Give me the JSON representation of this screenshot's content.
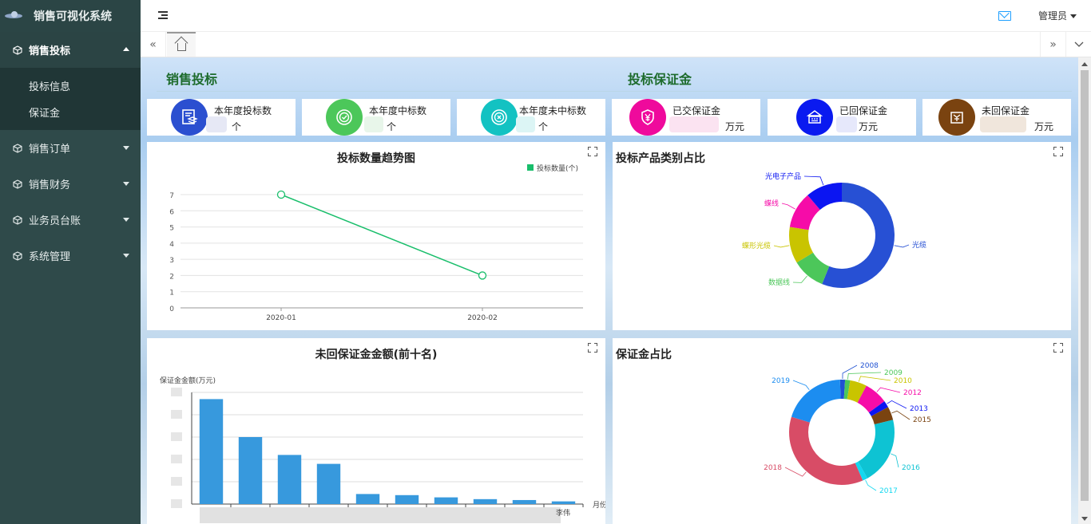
{
  "app": {
    "title": "销售可视化系统"
  },
  "sidebar": {
    "items": [
      {
        "label": "销售投标",
        "children": [
          {
            "label": "投标信息"
          },
          {
            "label": "保证金"
          }
        ]
      },
      {
        "label": "销售订单"
      },
      {
        "label": "销售财务"
      },
      {
        "label": "业务员台账"
      },
      {
        "label": "系统管理"
      }
    ]
  },
  "header": {
    "user": "管理员"
  },
  "sections": {
    "bid": "销售投标",
    "deposit": "投标保证金"
  },
  "stats": [
    {
      "label": "本年度投标数",
      "unit": "个",
      "color": "#2b4fd0"
    },
    {
      "label": "本年度中标数",
      "unit": "个",
      "color": "#4cc75a"
    },
    {
      "label": "本年度未中标数",
      "unit": "个",
      "color": "#13c2c2"
    },
    {
      "label": "已交保证金",
      "unit": "万元",
      "color": "#ef0a9c"
    },
    {
      "label": "已回保证金",
      "unit": "万元",
      "color": "#0a1af0"
    },
    {
      "label": "未回保证金",
      "unit": "万元",
      "color": "#7a4310"
    }
  ],
  "panels": {
    "trend": {
      "title": "投标数量趋势图"
    },
    "category": {
      "title": "投标产品类别占比"
    },
    "unreturned": {
      "title": "未回保证金金额(前十名)",
      "ylabel": "保证金金额(万元)",
      "xlabel": "月份",
      "last_name_fragment": "李伟"
    },
    "share": {
      "title": "保证金占比"
    }
  },
  "chart_data": [
    {
      "type": "line",
      "title": "投标数量趋势图",
      "x": [
        "2020-01",
        "2020-02"
      ],
      "series": [
        {
          "name": "投标数量(个)",
          "values": [
            7,
            2
          ],
          "color": "#19be6b"
        }
      ],
      "ylim": [
        0,
        7
      ],
      "yticks": [
        0,
        1,
        2,
        3,
        4,
        5,
        6,
        7
      ],
      "legend": "top-right",
      "grid": true
    },
    {
      "type": "pie",
      "title": "投标产品类别占比",
      "slices": [
        {
          "name": "光缆",
          "value": 55,
          "color": "#2750d4"
        },
        {
          "name": "数据线",
          "value": 10,
          "color": "#4cc75a"
        },
        {
          "name": "蝶形光缆",
          "value": 11,
          "color": "#c9c400"
        },
        {
          "name": "蝶线",
          "value": 11,
          "color": "#f60ca8"
        },
        {
          "name": "光电子产品",
          "value": 11,
          "color": "#0b15f2"
        }
      ]
    },
    {
      "type": "bar",
      "title": "未回保证金金额(前十名)",
      "values": [
        47,
        30,
        22,
        18,
        4.5,
        4,
        3,
        2.2,
        1.8,
        1.2
      ],
      "ylim": [
        0,
        50
      ],
      "color": "#3799dd"
    },
    {
      "type": "pie",
      "title": "保证金占比",
      "slices": [
        {
          "name": "2008",
          "value": 1.5,
          "color": "#1f51d2"
        },
        {
          "name": "2009",
          "value": 1.5,
          "color": "#4cc75a"
        },
        {
          "name": "2010",
          "value": 5,
          "color": "#c9c400"
        },
        {
          "name": "2012",
          "value": 7,
          "color": "#f60ca8"
        },
        {
          "name": "2013",
          "value": 2,
          "color": "#0b15f2"
        },
        {
          "name": "2015",
          "value": 4,
          "color": "#7a4310"
        },
        {
          "name": "2016",
          "value": 20,
          "color": "#0ec3d3"
        },
        {
          "name": "2017",
          "value": 1.5,
          "color": "#12d8f0"
        },
        {
          "name": "2018",
          "value": 35,
          "color": "#d84c66"
        },
        {
          "name": "2019",
          "value": 19,
          "color": "#1c8df0"
        }
      ]
    }
  ]
}
